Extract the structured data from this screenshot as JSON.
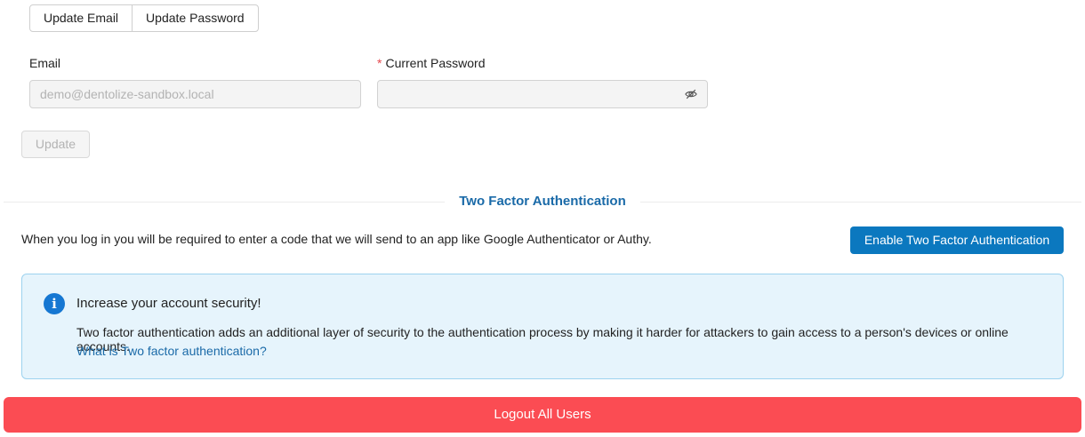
{
  "tabs": [
    {
      "label": "Update Email"
    },
    {
      "label": "Update Password"
    }
  ],
  "email": {
    "label": "Email",
    "value": "demo@dentolize-sandbox.local"
  },
  "current_password": {
    "required_marker": "*",
    "label": "Current Password",
    "value": "",
    "visibility_icon": "eye-off-icon"
  },
  "update_button": "Update",
  "two_factor": {
    "section_title": "Two Factor Authentication",
    "description": "When you log in you will be required to enter a code that we will send to an app like Google Authenticator or Authy.",
    "enable_button": "Enable Two Factor Authentication",
    "alert": {
      "icon": "info-icon",
      "icon_glyph": "i",
      "title": "Increase your account security!",
      "body": "Two factor authentication adds an additional layer of security to the authentication process by making it harder for attackers to gain access to a person's devices or online accounts.",
      "link": "What is Two factor authentication?"
    }
  },
  "logout_button": "Logout All Users",
  "colors": {
    "primary": "#0b78bf",
    "danger": "#fb4c53",
    "link": "#1a6aa8",
    "info_bg": "#e6f4fc",
    "info_border": "#9dd2ef"
  }
}
